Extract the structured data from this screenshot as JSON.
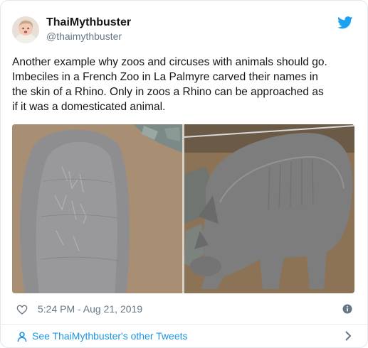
{
  "tweet": {
    "display_name": "ThaiMythbuster",
    "handle": "@thaimythbuster",
    "text": "Another example why zoos and circuses with animals should go.\nImbeciles in a French Zoo in La Palmyre carved their names  in\nthe skin of a Rhino. Only in zoos  a Rhino can be approached as\nif it was a domesticated animal.",
    "timestamp": "5:24 PM - Aug 21, 2019",
    "footer_link": "See ThaiMythbuster's other Tweets"
  },
  "icons": {
    "brand": "twitter-bird-icon",
    "like": "heart-icon",
    "info": "info-icon",
    "profile": "person-icon",
    "more": "chevron-right-icon"
  },
  "colors": {
    "brand_blue": "#1da1f2",
    "link_blue": "#1b95e0",
    "secondary_text": "#657786",
    "primary_text": "#14171a"
  }
}
